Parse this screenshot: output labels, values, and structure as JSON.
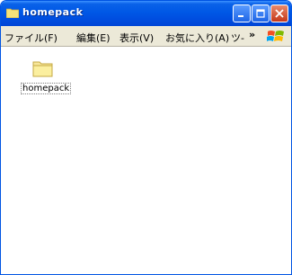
{
  "window": {
    "title": "homepack",
    "accent": "#0054e3"
  },
  "menu": {
    "items": [
      "ファイル(F)",
      "編集(E)",
      "表示(V)",
      "お気に入り(A)",
      "ツ-"
    ],
    "overflow": "»"
  },
  "content": {
    "folder_label": "homepack"
  }
}
